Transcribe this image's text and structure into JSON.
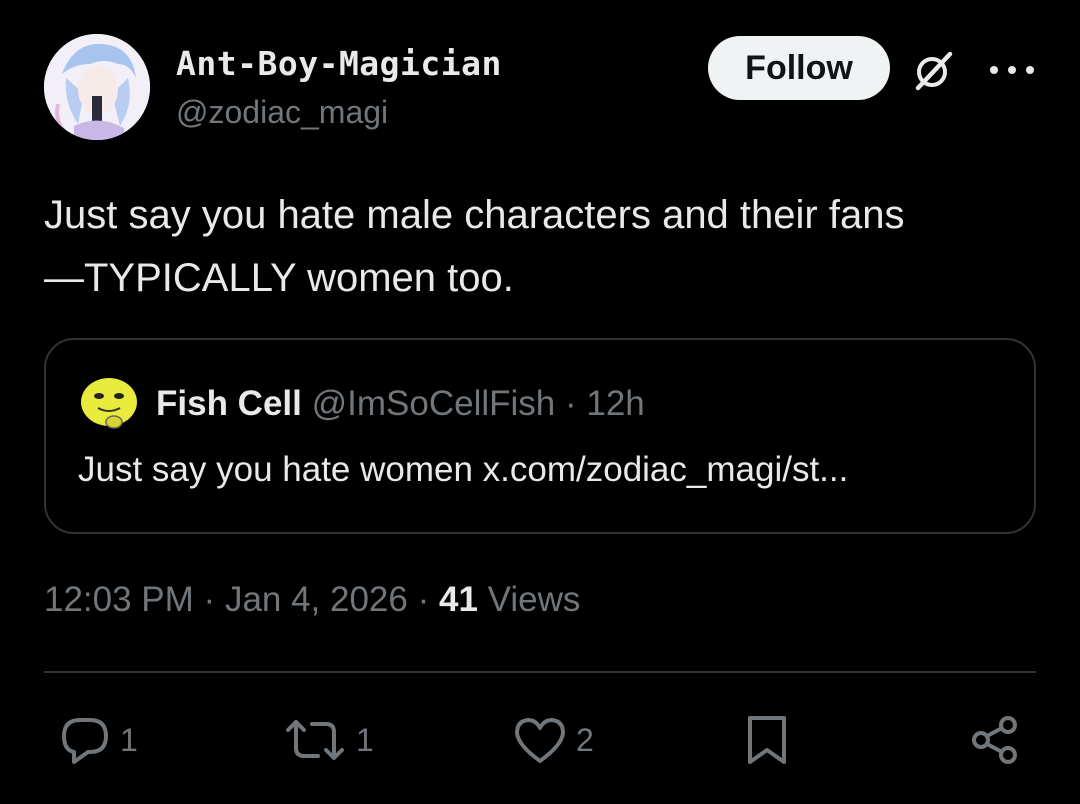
{
  "author": {
    "display_name": "Ant-Boy-Magician",
    "handle": "@zodiac_magi"
  },
  "follow_label": "Follow",
  "tweet": {
    "line1": "Just say you hate male characters and their fans",
    "line2": "—TYPICALLY women too."
  },
  "quote": {
    "name": "Fish Cell",
    "handle": "@ImSoCellFish",
    "separator": "·",
    "time": "12h",
    "text": "Just say you hate women x.com/zodiac_magi/st..."
  },
  "meta": {
    "time": "12:03 PM",
    "separator": "·",
    "date": "Jan 4, 2026",
    "views_count": "41",
    "views_label": "Views"
  },
  "actions": {
    "replies": "1",
    "reposts": "1",
    "likes": "2"
  },
  "colors": {
    "background": "#000000",
    "text": "#e7e9ea",
    "secondary": "#71767b",
    "border": "#2f3336",
    "follow_bg": "#eff3f4"
  },
  "icons": [
    "grok-icon",
    "more-icon",
    "reply-icon",
    "repost-icon",
    "like-icon",
    "bookmark-icon",
    "share-icon"
  ]
}
